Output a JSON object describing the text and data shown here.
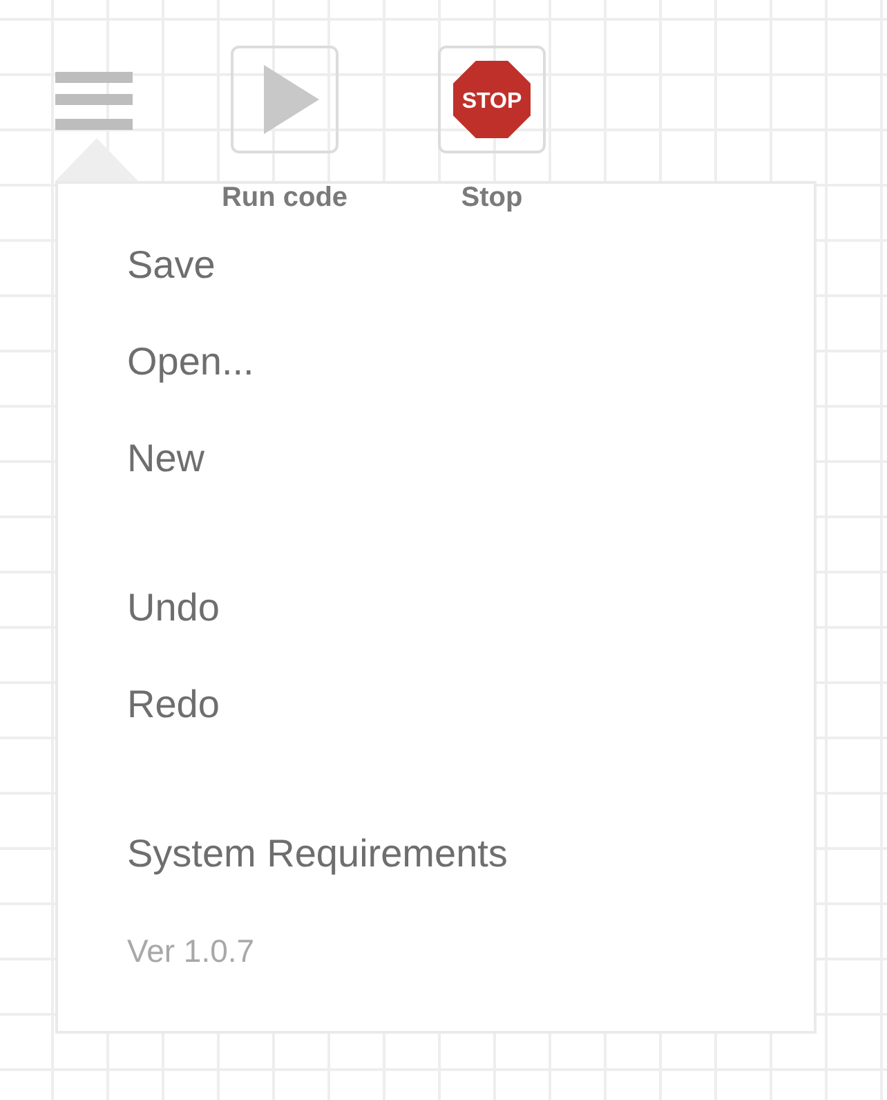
{
  "toolbar": {
    "menu_button": {
      "expanded": true
    },
    "tools": [
      {
        "kind": "run",
        "label": "Run code"
      },
      {
        "kind": "stop",
        "icon_text": "STOP",
        "label": "Stop"
      }
    ]
  },
  "menu": {
    "sections": [
      [
        "Save",
        "Open...",
        "New"
      ],
      [
        "Undo",
        "Redo"
      ],
      [
        "System Requirements"
      ]
    ],
    "version": "Ver 1.0.7"
  }
}
